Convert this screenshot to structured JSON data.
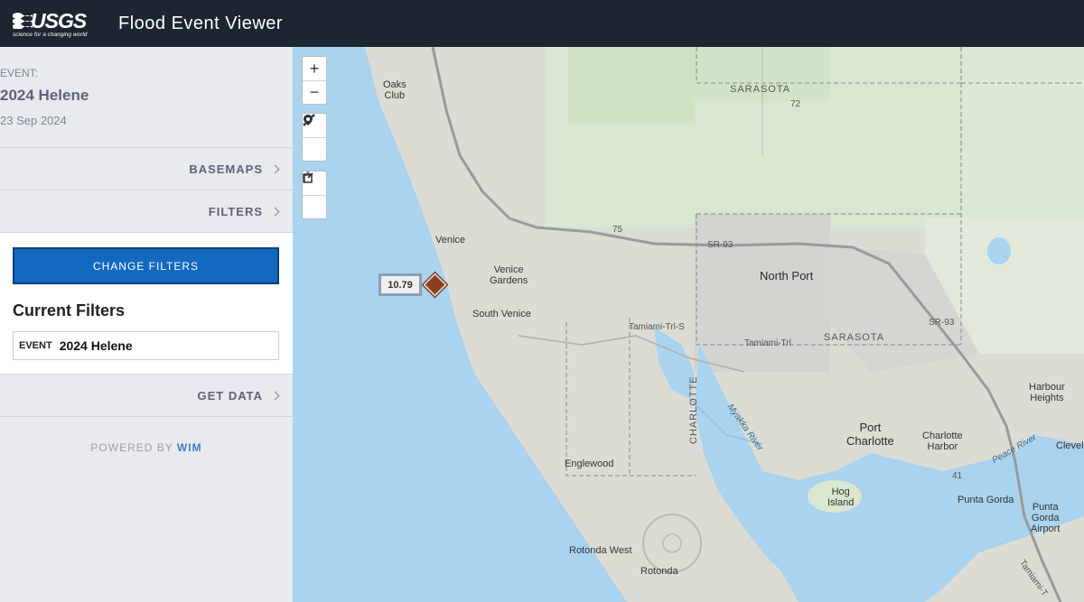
{
  "header": {
    "logo_text": "USGS",
    "logo_tagline": "science for a changing world",
    "app_title": "Flood Event Viewer"
  },
  "sidebar": {
    "event_label": "EVENT:",
    "event_name": "2024 Helene",
    "event_date": "23 Sep 2024",
    "basemaps_label": "BASEMAPS",
    "filters_label": "FILTERS",
    "change_filters_label": "CHANGE FILTERS",
    "current_filters_title": "Current Filters",
    "filter_chip": {
      "key": "EVENT",
      "value": "2024 Helene"
    },
    "get_data_label": "GET DATA",
    "powered_by": "POWERED BY",
    "powered_brand": "WIM"
  },
  "map": {
    "zoom_in": "+",
    "zoom_out": "−",
    "tools": [
      "measure-icon",
      "location-icon",
      "edit-icon",
      "trash-icon"
    ],
    "gauge_value": "10.79",
    "gauge_color": "#8a3d1d",
    "water_color": "#a9d3ef",
    "land_color": "#dcdcd4",
    "places": {
      "oaks_club": "Oaks\nClub",
      "sarasota_county": "SARASOTA",
      "sarasota_county_2": "SARASOTA",
      "route_72": "72",
      "route_75": "75",
      "sr93": "SR-93",
      "sr93_b": "SR-93",
      "venice": "Venice",
      "venice_gardens": "Venice\nGardens",
      "south_venice": "South Venice",
      "north_port": "North Port",
      "tamiami_s": "Tamiami-Trl-S",
      "tamiami": "Tamiami-Trl",
      "tamiami_b": "Tamiami-T",
      "harbour_heights": "Harbour\nHeights",
      "port_charlotte": "Port\nCharlotte",
      "charlotte_harbor": "Charlotte\nHarbor",
      "charlotte_county": "CHARLOTTE",
      "myakka_river": "Myakka River",
      "peace_river": "Peace River",
      "cleveland": "Clevel",
      "englewood": "Englewood",
      "hog_island": "Hog\nIsland",
      "punta_gorda": "Punta Gorda",
      "punta_gorda_airport": "Punta\nGorda\nAirport",
      "route_41": "41",
      "rotonda_west": "Rotonda West",
      "rotonda": "Rotonda"
    }
  }
}
